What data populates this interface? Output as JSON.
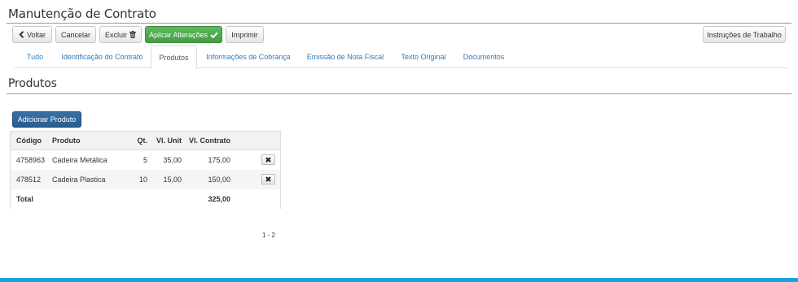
{
  "page": {
    "title": "Manutenção de Contrato"
  },
  "toolbar": {
    "back_label": "Voltar",
    "cancel_label": "Cancelar",
    "delete_label": "Excluir",
    "apply_label": "Aplicar Alterações",
    "print_label": "Imprimir",
    "instructions_label": "Instruções de Trabalho"
  },
  "tabs": [
    {
      "label": "Tudo"
    },
    {
      "label": "Identificação do Contrato"
    },
    {
      "label": "Produtos"
    },
    {
      "label": "Informações de Cobrança"
    },
    {
      "label": "Emissão de Nota Fiscal"
    },
    {
      "label": "Texto Original"
    },
    {
      "label": "Documentos"
    }
  ],
  "active_tab": "Produtos",
  "section": {
    "title": "Produtos",
    "add_label": "Adicionar Produto"
  },
  "table": {
    "columns": [
      "Código",
      "Produto",
      "Qt.",
      "Vl. Unit",
      "Vl. Contrato"
    ],
    "rows": [
      {
        "code": "4758963",
        "product": "Cadeira Metálica",
        "qty": "5",
        "unit": "35,00",
        "total": "175,00"
      },
      {
        "code": "478512",
        "product": "Cadeira Plastica",
        "qty": "10",
        "unit": "15,00",
        "total": "150,00"
      }
    ],
    "total_label": "Total",
    "total_value": "325,00"
  },
  "pagination": {
    "text": "1 - 2"
  },
  "colors": {
    "success": "#5cb85c",
    "primary": "#337ab7",
    "footer": "#1aa3dc"
  },
  "icons": {
    "back": "chevron-left-icon",
    "delete": "trash-icon",
    "apply": "check-icon",
    "remove_row": "times-icon"
  }
}
